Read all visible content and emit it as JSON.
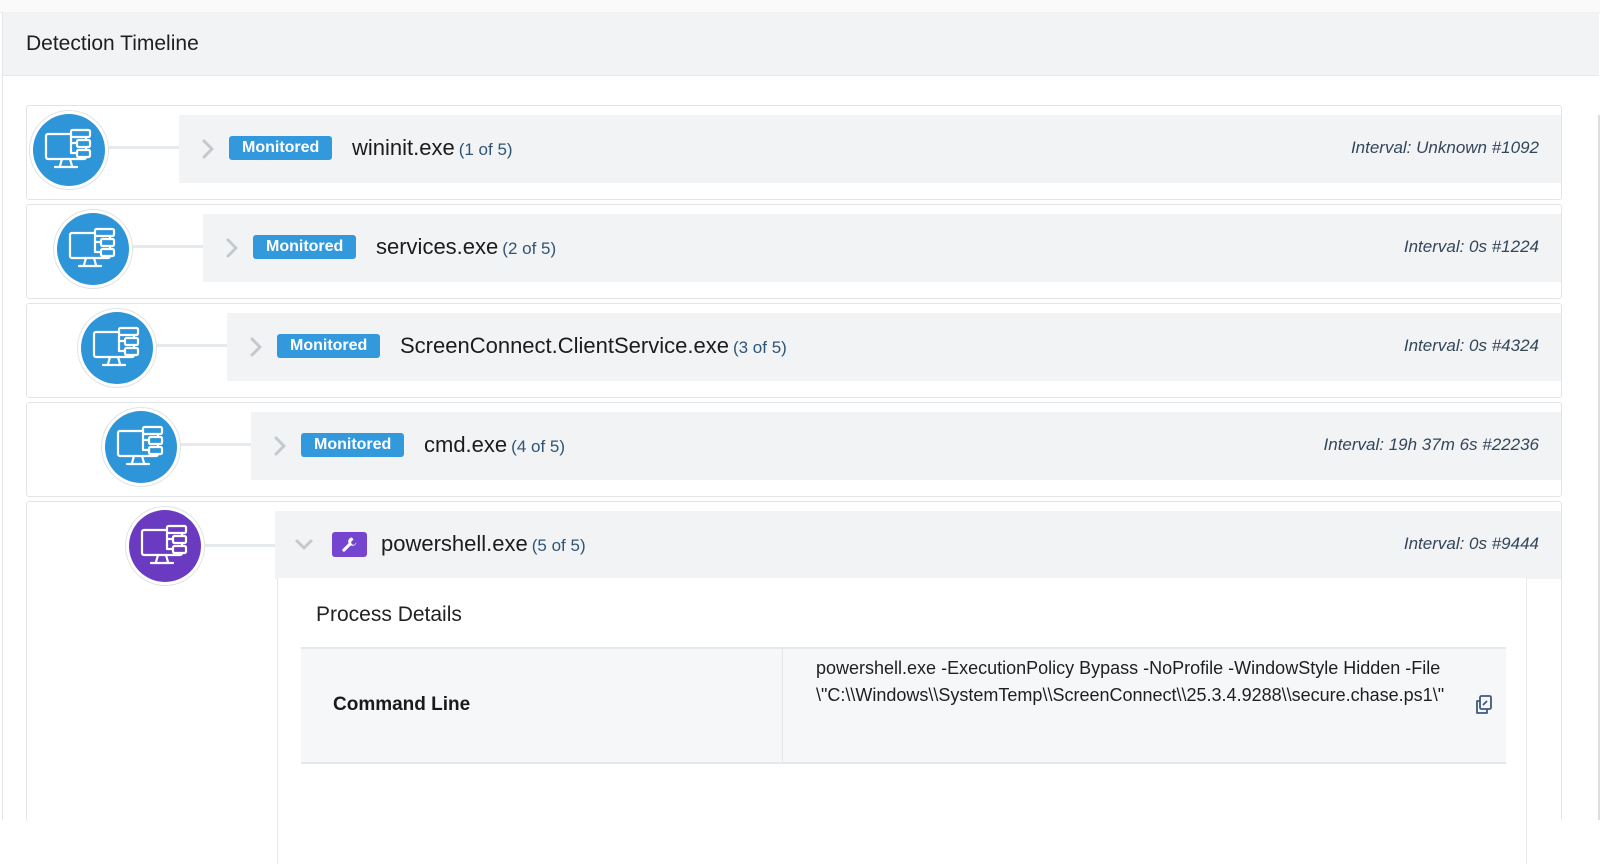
{
  "panel": {
    "title": "Detection Timeline"
  },
  "rows": [
    {
      "badge": "Monitored",
      "name": "wininit.exe",
      "count": "(1 of 5)",
      "interval": "Interval: Unknown #1092"
    },
    {
      "badge": "Monitored",
      "name": "services.exe",
      "count": "(2 of 5)",
      "interval": "Interval: 0s #1224"
    },
    {
      "badge": "Monitored",
      "name": "ScreenConnect.ClientService.exe",
      "count": "(3 of 5)",
      "interval": "Interval: 0s #4324"
    },
    {
      "badge": "Monitored",
      "name": "cmd.exe",
      "count": "(4 of 5)",
      "interval": "Interval: 19h 37m 6s #22236"
    },
    {
      "name": "powershell.exe",
      "count": "(5 of 5)",
      "interval": "Interval: 0s #9444"
    }
  ],
  "details": {
    "title": "Process Details",
    "command_line_label": "Command Line",
    "command_line_value": "powershell.exe -ExecutionPolicy Bypass -NoProfile -WindowStyle Hidden -File \\\"C:\\\\Windows\\\\SystemTemp\\\\ScreenConnect\\\\25.3.4.9288\\\\secure.chase.ps1\\\""
  },
  "icons": {
    "node": "computer-process-icon",
    "expand": "chevron-right-icon",
    "collapse": "chevron-down-icon",
    "tool": "wrench-icon",
    "copy": "copy-icon"
  },
  "colors": {
    "node_blue": "#2e95d8",
    "node_purple": "#6a3bc0",
    "badge_blue": "#3399dd",
    "wrench_purple": "#7645cf"
  }
}
